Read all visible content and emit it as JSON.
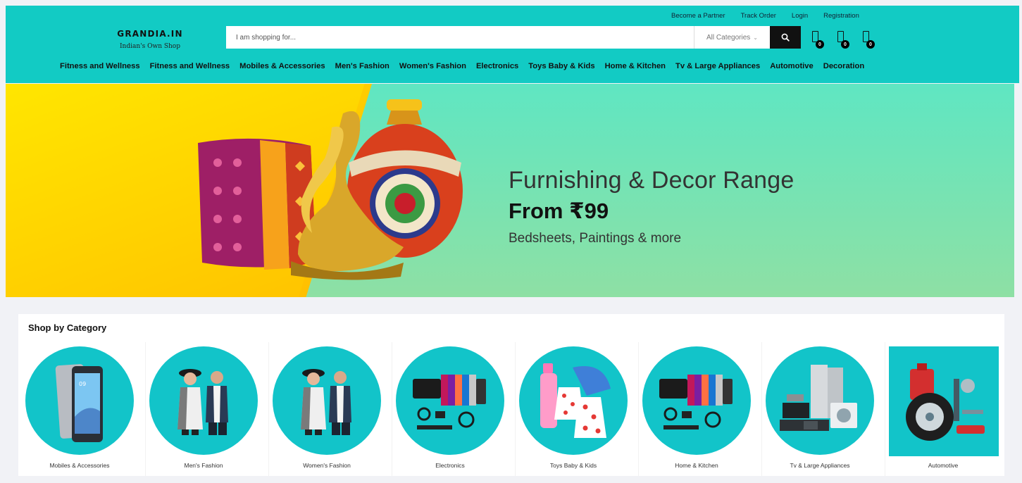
{
  "header": {
    "logo_title": "GRANDIA.IN",
    "logo_tagline": "Indian's Own Shop",
    "top_links": [
      "Become a Partner",
      "Track Order",
      "Login",
      "Registration"
    ],
    "search_placeholder": "I am shopping for...",
    "category_select": "All Categories",
    "icon_counts": [
      "0",
      "0",
      "0"
    ],
    "nav": [
      "Fitness and Wellness",
      "Fitness and Wellness",
      "Mobiles & Accessories",
      "Men's Fashion",
      "Women's Fashion",
      "Electronics",
      "Toys Baby & Kids",
      "Home & Kitchen",
      "Tv & Large Appliances",
      "Automotive",
      "Decoration"
    ]
  },
  "banner": {
    "headline": "Furnishing & Decor Range",
    "price": "From ₹99",
    "subtext": "Bedsheets, Paintings & more"
  },
  "shop": {
    "title": "Shop by Category",
    "categories": [
      {
        "label": "Mobiles & Accessories",
        "icon": "smartphone-icon"
      },
      {
        "label": "Men's Fashion",
        "icon": "fashion-couple-icon"
      },
      {
        "label": "Women's Fashion",
        "icon": "fashion-couple-icon"
      },
      {
        "label": "Electronics",
        "icon": "electronics-icon"
      },
      {
        "label": "Toys Baby & Kids",
        "icon": "baby-products-icon"
      },
      {
        "label": "Home & Kitchen",
        "icon": "electronics-icon"
      },
      {
        "label": "Tv & Large Appliances",
        "icon": "appliances-icon"
      },
      {
        "label": "Automotive",
        "icon": "tire-icon"
      }
    ]
  },
  "colors": {
    "brand_teal": "#12cbc4",
    "category_teal": "#12c4c9",
    "search_button": "#111111"
  }
}
